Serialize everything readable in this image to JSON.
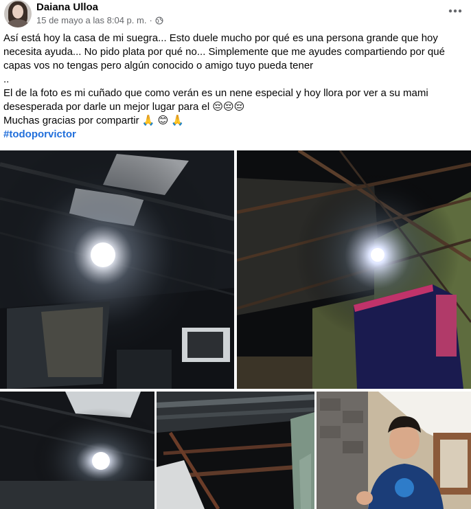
{
  "author": {
    "name": "Daiana Ulloa",
    "timestamp": "15 de mayo a las 8:04 p. m.",
    "separator": "·",
    "audience_icon": "globe-icon"
  },
  "actions": {
    "more_icon": "more-horizontal-icon"
  },
  "post": {
    "line1": "Así está hoy la casa de mi suegra... Esto duele mucho por qué es una persona grande que hoy necesita ayuda... No pido plata por qué no... Simplemente que me ayudes compartiendo por qué capas vos no tengas pero algún conocido o amigo tuyo pueda tener",
    "line2": "..",
    "line3": "El de la foto es mi cuñado que como verán es un nene especial y hoy llora por ver a su mami desesperada por darle un mejor lugar para el 😔😔😔",
    "line4": "Muchas gracias por compartir 🙏 😊 🙏",
    "hashtag": "#todoporvictor"
  },
  "photos": [
    {
      "icon": "photo-ceiling-light"
    },
    {
      "icon": "photo-ceiling-curtain"
    },
    {
      "icon": "photo-ceiling-lamp"
    },
    {
      "icon": "photo-roof-beams"
    },
    {
      "icon": "photo-boy"
    }
  ],
  "colors": {
    "text": "#050505",
    "meta": "#65676b",
    "hashtag": "#216fdb"
  }
}
